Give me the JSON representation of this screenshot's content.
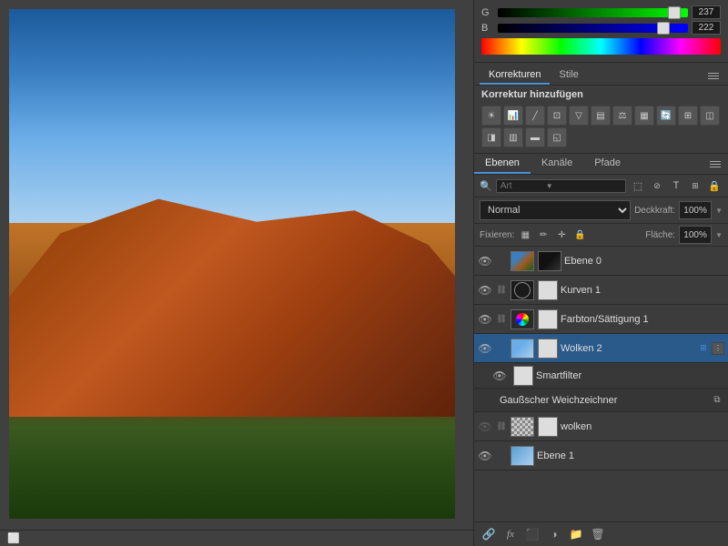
{
  "color_panel": {
    "g_label": "G",
    "g_value": "237",
    "b_label": "B",
    "b_value": "222"
  },
  "korrekturen": {
    "tab1": "Korrekturen",
    "tab2": "Stile",
    "title": "Korrektur hinzufügen",
    "icons": [
      "☀",
      "📊",
      "✂",
      "≈",
      "∇",
      "▣",
      "⚖",
      "▦",
      "📷",
      "↺",
      "▣",
      "",
      "",
      "",
      "",
      "",
      ""
    ]
  },
  "ebenen": {
    "tab1": "Ebenen",
    "tab2": "Kanäle",
    "tab3": "Pfade",
    "search_placeholder": "Art",
    "blend_mode": "Normal",
    "opacity_label": "Deckkraft:",
    "opacity_value": "100%",
    "fixieren_label": "Fixieren:",
    "flaeche_label": "Fläche:",
    "flaeche_value": "100%"
  },
  "layers": [
    {
      "id": "ebene0",
      "name": "Ebene 0",
      "visible": true,
      "type": "image",
      "selected": false
    },
    {
      "id": "kurven1",
      "name": "Kurven 1",
      "visible": true,
      "type": "adjustment",
      "selected": false
    },
    {
      "id": "farbton",
      "name": "Farbton/Sättigung 1",
      "visible": true,
      "type": "adjustment",
      "selected": false
    },
    {
      "id": "wolken2",
      "name": "Wolken 2",
      "visible": true,
      "type": "smart",
      "selected": true
    },
    {
      "id": "smartfilter",
      "name": "Smartfilter",
      "visible": true,
      "type": "smartfilter-label",
      "selected": false,
      "sub": true
    },
    {
      "id": "gausscher",
      "name": "Gaußscher Weichzeichner",
      "visible": false,
      "type": "filter",
      "selected": false,
      "sub": true
    },
    {
      "id": "wolken",
      "name": "wolken",
      "visible": false,
      "type": "checker",
      "selected": false
    },
    {
      "id": "ebene1",
      "name": "Ebene 1",
      "visible": true,
      "type": "blue",
      "selected": false
    }
  ],
  "bottom_toolbar": {
    "link": "🔗",
    "fx": "fx",
    "mask": "⬛",
    "adjustment": "◑",
    "folder": "📁",
    "trash": "🗑"
  }
}
